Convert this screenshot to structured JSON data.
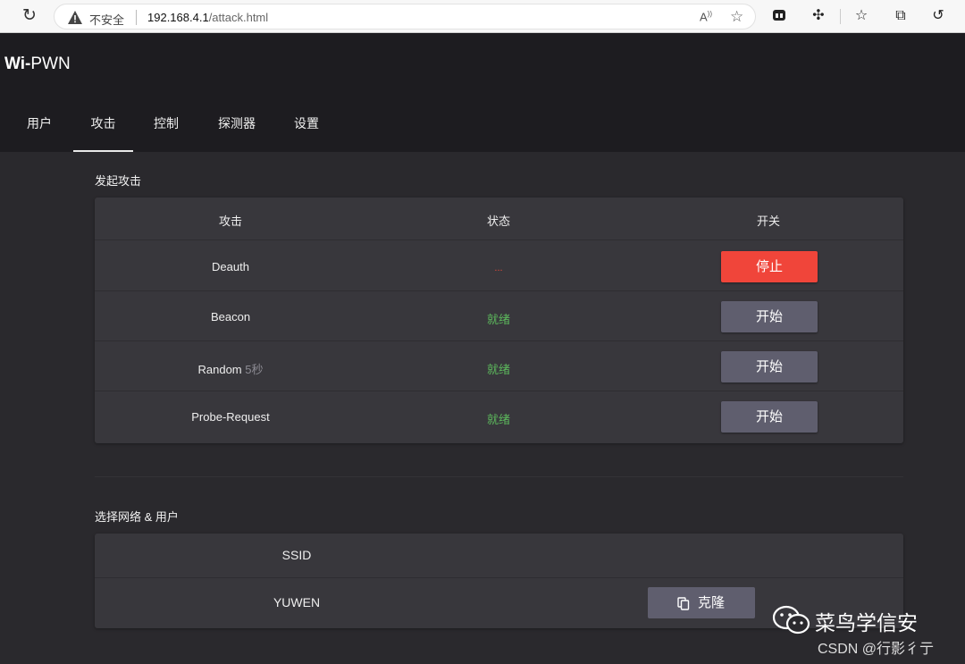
{
  "browser": {
    "insecure_label": "不安全",
    "url_host": "192.168.4.1",
    "url_path": "/attack.html",
    "read_aloud_label": "Aᵀ"
  },
  "app": {
    "brand_bold": "Wi-",
    "brand_rest": "PWN",
    "tabs": [
      {
        "label": "用户"
      },
      {
        "label": "攻击",
        "active": true
      },
      {
        "label": "控制"
      },
      {
        "label": "探测器"
      },
      {
        "label": "设置"
      }
    ]
  },
  "attack_section": {
    "title": "发起攻击",
    "headers": {
      "attack": "攻击",
      "status": "状态",
      "toggle": "开关"
    },
    "rows": [
      {
        "name": "Deauth",
        "status": "...",
        "button": "停止"
      },
      {
        "name": "Beacon",
        "status": "就绪",
        "button": "开始"
      },
      {
        "name": "Random",
        "name_suffix": "5秒",
        "status": "就绪",
        "button": "开始"
      },
      {
        "name": "Probe-Request",
        "status": "就绪",
        "button": "开始"
      }
    ]
  },
  "network_section": {
    "title": "选择网络 & 用户",
    "header": "SSID",
    "rows": [
      {
        "ssid": "YUWEN",
        "button": "克隆"
      }
    ]
  },
  "watermark": {
    "name": "菜鸟学信安",
    "sub": "CSDN @行影彳亍"
  },
  "colors": {
    "stop": "#f0453a",
    "ready": "#5cb85c",
    "status_running": "#e54a3a",
    "button": "#5f5e6e"
  }
}
